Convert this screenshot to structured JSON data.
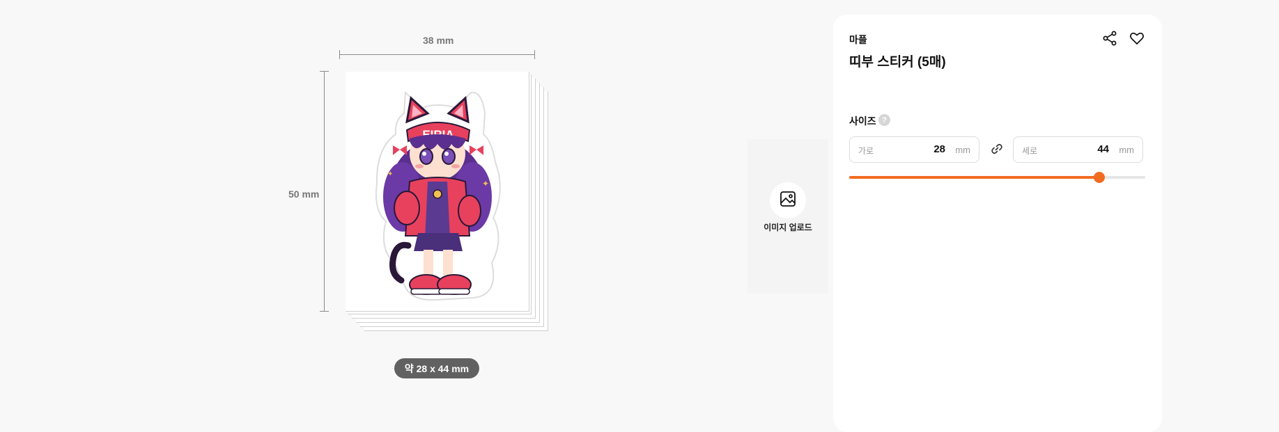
{
  "preview": {
    "width_label": "38 mm",
    "height_label": "50 mm",
    "size_summary": "약 28 x 44 mm",
    "sticker_text": "EIRIA"
  },
  "upload": {
    "label": "이미지 업로드",
    "icon": "image-icon"
  },
  "product": {
    "brand": "마플",
    "title": "띠부 스티커 (5매)",
    "share_icon": "share-icon",
    "favorite_icon": "heart-icon"
  },
  "size": {
    "label": "사이즈",
    "help": "?",
    "width": {
      "placeholder": "가로",
      "value": "28",
      "unit": "mm"
    },
    "height": {
      "placeholder": "세로",
      "value": "44",
      "unit": "mm"
    },
    "link_icon": "link-icon",
    "slider_fraction": 0.845
  },
  "colors": {
    "accent": "#f26b21",
    "pill": "#616161",
    "background": "#f8f8f8"
  }
}
